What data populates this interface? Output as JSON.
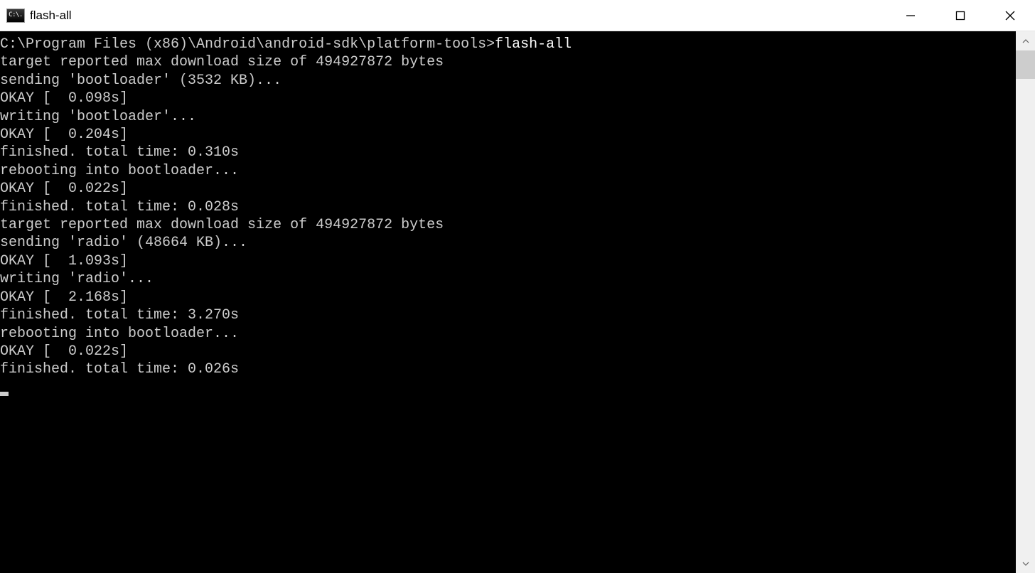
{
  "window": {
    "title": "flash-all",
    "icon_text": "C:\\."
  },
  "prompt": {
    "path": "C:\\Program Files (x86)\\Android\\android-sdk\\platform-tools>",
    "command": "flash-all"
  },
  "output_lines": [
    "target reported max download size of 494927872 bytes",
    "sending 'bootloader' (3532 KB)...",
    "OKAY [  0.098s]",
    "writing 'bootloader'...",
    "OKAY [  0.204s]",
    "finished. total time: 0.310s",
    "rebooting into bootloader...",
    "OKAY [  0.022s]",
    "finished. total time: 0.028s",
    "target reported max download size of 494927872 bytes",
    "sending 'radio' (48664 KB)...",
    "OKAY [  1.093s]",
    "writing 'radio'...",
    "OKAY [  2.168s]",
    "finished. total time: 3.270s",
    "rebooting into bootloader...",
    "OKAY [  0.022s]",
    "finished. total time: 0.026s"
  ]
}
